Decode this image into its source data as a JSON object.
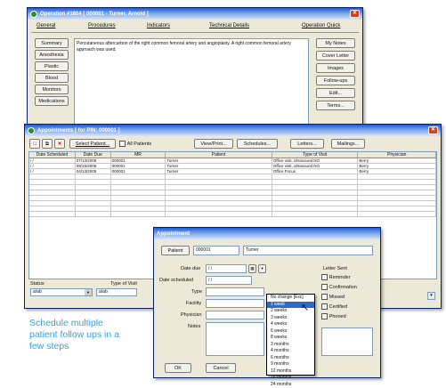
{
  "op_window": {
    "title": "Operation #1804 [ 000001 - Turner, Arnold ]",
    "quick_button": "Operation Quick",
    "tabs": [
      "General",
      "Procedures",
      "Indicators",
      "Technical Details"
    ],
    "left_buttons": [
      "Summary",
      "Anesthesia",
      "Plastic",
      "Blood",
      "Monitors",
      "Medications"
    ],
    "summary_text": "Percutaneous aftercarbon of the right common femoral artery and angioplasty. A right common femoral artery approach was used.",
    "right_buttons": [
      "My Notes",
      "Cover Letter",
      "Images",
      "Follow-ups",
      "Edit...",
      "Terms..."
    ]
  },
  "appt_window": {
    "title": "Appointments [ for PIN: 000001 ]",
    "toolbar": {
      "select_patient": "Select Patient...",
      "all_patients": "All Patients",
      "view_print": "View/Print...",
      "schedules": "Schedules...",
      "letters": "Letters...",
      "mailings": "Mailings..."
    },
    "columns": [
      "Date Scheduled",
      "Date Due",
      "MR",
      "Patient",
      "Type of Visit",
      "Physician"
    ],
    "rows": [
      [
        "/ /",
        "07/13/2006",
        "000001",
        "Turner",
        "Office visit, ultrasound NO",
        "Berry"
      ],
      [
        "/ /",
        "09/15/2006",
        "000001",
        "Turner",
        "Office visit, ultrasound NO",
        "Berry"
      ],
      [
        "/ /",
        "04/13/2005",
        "000001",
        "Turner",
        "Office Focus",
        "Berry"
      ]
    ],
    "status_label": "Status",
    "status_value": "a/ab",
    "type_label": "Type of Visit",
    "type_value": "a/ab"
  },
  "appointment_dialog": {
    "title": "Appointment",
    "patient_label": "Patient",
    "patient_id": "000001",
    "patient_name": "Turner",
    "date_due_label": "Date due",
    "date_due_value": "/ /",
    "date_scheduled_label": "Date scheduled",
    "date_scheduled_value": "/ /",
    "type_label": "Type",
    "facility_label": "Facility",
    "physician_label": "Physician",
    "notes_label": "Notes",
    "letter_sent_label": "Letter Sent",
    "checkbox_labels": [
      "Reminder",
      "Confirmation",
      "Missed",
      "Certified",
      "Phoned"
    ],
    "ok": "OK",
    "cancel": "Cancel",
    "dropdown_options": [
      "No change [Esc]",
      "1 week",
      "2 weeks",
      "3 weeks",
      "4 weeks",
      "6 weeks",
      "8 weeks",
      "3 months",
      "4 months",
      "6 months",
      "9 months",
      "12 months",
      "18 months",
      "24 months"
    ],
    "dropdown_selected_index": 1
  },
  "caption": "Schedule multiple patient follow ups in a few steps"
}
